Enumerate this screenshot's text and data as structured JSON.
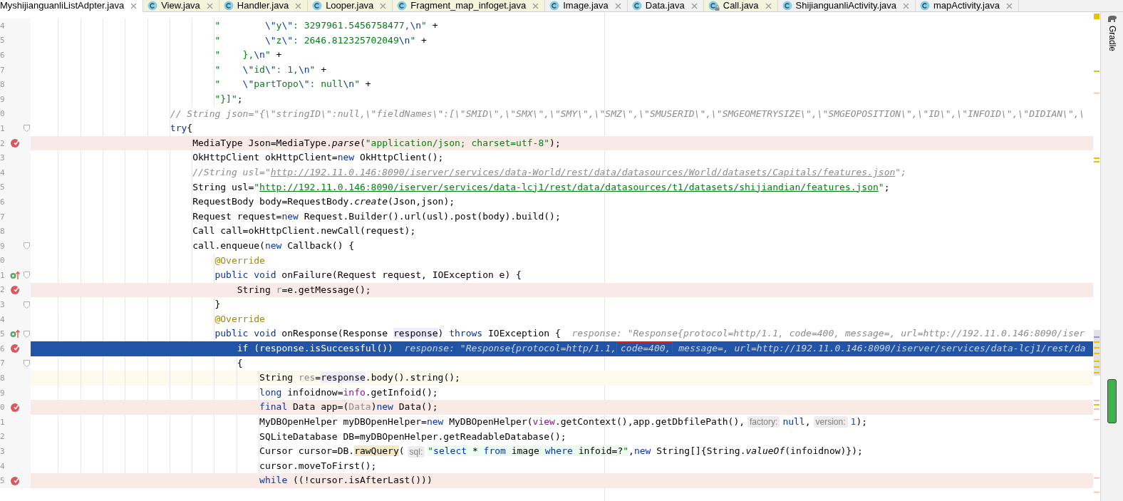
{
  "tabs": [
    {
      "label": "MyshijianguanliListAdpter.java",
      "selected": true,
      "color": "#ffffff",
      "icon": false,
      "locked": false
    },
    {
      "label": "View.java",
      "selected": false,
      "color": "#f4f4dd",
      "icon": true,
      "locked": false
    },
    {
      "label": "Handler.java",
      "selected": false,
      "color": "#f4f4dd",
      "icon": true,
      "locked": false
    },
    {
      "label": "Looper.java",
      "selected": false,
      "color": "#f4f4dd",
      "icon": true,
      "locked": false
    },
    {
      "label": "Fragment_map_infoget.java",
      "selected": false,
      "color": "#f4f4dd",
      "icon": true,
      "locked": false
    },
    {
      "label": "Image.java",
      "selected": false,
      "color": "#f2f2f2",
      "icon": true,
      "locked": false
    },
    {
      "label": "Data.java",
      "selected": false,
      "color": "#f2f2f2",
      "icon": true,
      "locked": false
    },
    {
      "label": "Call.java",
      "selected": false,
      "color": "#f4f4dd",
      "icon": true,
      "locked": true
    },
    {
      "label": "ShijianguanliActivity.java",
      "selected": false,
      "color": "#f2f2f2",
      "icon": true,
      "locked": false
    },
    {
      "label": "mapActivity.java",
      "selected": false,
      "color": "#f2f2f2",
      "icon": true,
      "locked": false
    }
  ],
  "editor": {
    "lines": [
      {
        "number": "4",
        "kind": "plain",
        "breakpoint": false,
        "override": false,
        "fold": false,
        "tokens": [
          {
            "kind": "string",
            "text": "                                \"        "
          },
          {
            "kind": "escape",
            "text": "\\\""
          },
          {
            "kind": "string",
            "text": "y"
          },
          {
            "kind": "escape",
            "text": "\\\""
          },
          {
            "kind": "string",
            "text": ": 3297961.5456758477,"
          },
          {
            "kind": "escape",
            "text": "\\n"
          },
          {
            "kind": "string",
            "text": "\""
          },
          {
            "kind": "plain",
            "text": " +"
          }
        ]
      },
      {
        "number": "5",
        "kind": "plain",
        "breakpoint": false,
        "override": false,
        "fold": false,
        "tokens": [
          {
            "kind": "string",
            "text": "                                \"        "
          },
          {
            "kind": "escape",
            "text": "\\\""
          },
          {
            "kind": "string",
            "text": "z"
          },
          {
            "kind": "escape",
            "text": "\\\""
          },
          {
            "kind": "string",
            "text": ": 2646.812325702049"
          },
          {
            "kind": "escape",
            "text": "\\n"
          },
          {
            "kind": "string",
            "text": "\""
          },
          {
            "kind": "plain",
            "text": " +"
          }
        ]
      },
      {
        "number": "6",
        "kind": "plain",
        "breakpoint": false,
        "override": false,
        "fold": false,
        "tokens": [
          {
            "kind": "string",
            "text": "                                \"    },"
          },
          {
            "kind": "escape",
            "text": "\\n"
          },
          {
            "kind": "string",
            "text": "\""
          },
          {
            "kind": "plain",
            "text": " +"
          }
        ]
      },
      {
        "number": "7",
        "kind": "plain",
        "breakpoint": false,
        "override": false,
        "fold": false,
        "tokens": [
          {
            "kind": "string",
            "text": "                                \"    "
          },
          {
            "kind": "escape",
            "text": "\\\""
          },
          {
            "kind": "string",
            "text": "id"
          },
          {
            "kind": "escape",
            "text": "\\\""
          },
          {
            "kind": "string",
            "text": ": 1,"
          },
          {
            "kind": "escape",
            "text": "\\n"
          },
          {
            "kind": "string",
            "text": "\""
          },
          {
            "kind": "plain",
            "text": " +"
          }
        ]
      },
      {
        "number": "8",
        "kind": "plain",
        "breakpoint": false,
        "override": false,
        "fold": false,
        "tokens": [
          {
            "kind": "string",
            "text": "                                \"    "
          },
          {
            "kind": "escape",
            "text": "\\\""
          },
          {
            "kind": "string",
            "text": "partTopo"
          },
          {
            "kind": "escape",
            "text": "\\\""
          },
          {
            "kind": "string",
            "text": ": null"
          },
          {
            "kind": "escape",
            "text": "\\n"
          },
          {
            "kind": "string",
            "text": "\""
          },
          {
            "kind": "plain",
            "text": " +"
          }
        ]
      },
      {
        "number": "9",
        "kind": "plain",
        "breakpoint": false,
        "override": false,
        "fold": false,
        "tokens": [
          {
            "kind": "string",
            "text": "                                \"}]\""
          },
          {
            "kind": "plain",
            "text": ";"
          }
        ]
      },
      {
        "number": "0",
        "kind": "plain",
        "breakpoint": false,
        "override": false,
        "fold": false,
        "tokens": [
          {
            "kind": "comment",
            "text": "                        // String json=\"{\\\"stringID\\\":null,\\\"fieldNames\\\":[\\\"SMID\\\",\\\"SMX\\\",\\\"SMY\\\",\\\"SMZ\\\",\\\"SMUSERID\\\",\\\"SMGEOMETRYSIZE\\\",\\\"SMGEOPOSITION\\\",\\\"ID\\\",\\\"INFOID\\\",\\\"DIDIAN\\\",\\"
          }
        ]
      },
      {
        "number": "1",
        "kind": "plain",
        "breakpoint": false,
        "override": false,
        "fold": true,
        "tokens": [
          {
            "kind": "keyword",
            "text": "                        try"
          },
          {
            "kind": "plain",
            "text": "{"
          }
        ]
      },
      {
        "number": "2",
        "kind": "breakpoint",
        "breakpoint": true,
        "override": false,
        "fold": false,
        "tokens": [
          {
            "kind": "plain",
            "text": "                            MediaType Json=MediaType."
          },
          {
            "kind": "static",
            "text": "parse"
          },
          {
            "kind": "plain",
            "text": "("
          },
          {
            "kind": "string",
            "text": "\"application/json; charset=utf-8\""
          },
          {
            "kind": "plain",
            "text": ");"
          }
        ]
      },
      {
        "number": "3",
        "kind": "plain",
        "breakpoint": false,
        "override": false,
        "fold": false,
        "tokens": [
          {
            "kind": "plain",
            "text": "                            OkHttpClient okHttpClient="
          },
          {
            "kind": "keyword",
            "text": "new"
          },
          {
            "kind": "plain",
            "text": " OkHttpClient();"
          }
        ]
      },
      {
        "number": "4",
        "kind": "plain",
        "breakpoint": false,
        "override": false,
        "fold": false,
        "tokens": [
          {
            "kind": "comment",
            "text": "                            //String usl=\""
          },
          {
            "kind": "comment-link",
            "text": "http://192.11.0.146:8090/iserver/services/data-World/rest/data/datasources/World/datasets/Capitals/features.json"
          },
          {
            "kind": "comment",
            "text": "\";"
          }
        ]
      },
      {
        "number": "5",
        "kind": "plain",
        "breakpoint": false,
        "override": false,
        "fold": false,
        "tokens": [
          {
            "kind": "plain",
            "text": "                            String usl="
          },
          {
            "kind": "string",
            "text": "\""
          },
          {
            "kind": "link",
            "text": "http://192.11.0.146:8090/iserver/services/data-lcj1/rest/data/datasources/t1/datasets/shijiandian/features.json"
          },
          {
            "kind": "string",
            "text": "\""
          },
          {
            "kind": "plain",
            "text": ";"
          }
        ]
      },
      {
        "number": "6",
        "kind": "plain",
        "breakpoint": false,
        "override": false,
        "fold": false,
        "tokens": [
          {
            "kind": "plain",
            "text": "                            RequestBody body=RequestBody."
          },
          {
            "kind": "static",
            "text": "create"
          },
          {
            "kind": "plain",
            "text": "(Json,json);"
          }
        ]
      },
      {
        "number": "7",
        "kind": "plain",
        "breakpoint": false,
        "override": false,
        "fold": false,
        "tokens": [
          {
            "kind": "plain",
            "text": "                            Request request="
          },
          {
            "kind": "keyword",
            "text": "new"
          },
          {
            "kind": "plain",
            "text": " Request.Builder().url(usl).post(body).build();"
          }
        ]
      },
      {
        "number": "8",
        "kind": "plain",
        "breakpoint": false,
        "override": false,
        "fold": false,
        "tokens": [
          {
            "kind": "plain",
            "text": "                            Call call=okHttpClient.newCall(request);"
          }
        ]
      },
      {
        "number": "9",
        "kind": "plain",
        "breakpoint": false,
        "override": false,
        "fold": true,
        "tokens": [
          {
            "kind": "plain",
            "text": "                            call.enqueue("
          },
          {
            "kind": "keyword",
            "text": "new"
          },
          {
            "kind": "plain",
            "text": " Callback() {"
          }
        ]
      },
      {
        "number": "0",
        "kind": "plain",
        "breakpoint": false,
        "override": false,
        "fold": false,
        "tokens": [
          {
            "kind": "annotation",
            "text": "                                @Override"
          }
        ]
      },
      {
        "number": "1",
        "kind": "plain",
        "breakpoint": false,
        "override": true,
        "fold": true,
        "tokens": [
          {
            "kind": "keyword",
            "text": "                                public void"
          },
          {
            "kind": "plain",
            "text": " onFailure(Request request, IOException e) {"
          }
        ]
      },
      {
        "number": "2",
        "kind": "breakpoint",
        "breakpoint": true,
        "override": false,
        "fold": false,
        "tokens": [
          {
            "kind": "plain",
            "text": "                                    String "
          },
          {
            "kind": "unused",
            "text": "r"
          },
          {
            "kind": "plain",
            "text": "=e.getMessage();"
          }
        ]
      },
      {
        "number": "3",
        "kind": "plain",
        "breakpoint": false,
        "override": false,
        "fold": true,
        "tokens": [
          {
            "kind": "plain",
            "text": "                                }"
          }
        ]
      },
      {
        "number": "4",
        "kind": "plain",
        "breakpoint": false,
        "override": false,
        "fold": false,
        "tokens": [
          {
            "kind": "annotation",
            "text": "                                @Override"
          }
        ]
      },
      {
        "number": "5",
        "kind": "plain",
        "breakpoint": false,
        "override": true,
        "fold": true,
        "tokens": [
          {
            "kind": "keyword",
            "text": "                                public void"
          },
          {
            "kind": "plain",
            "text": " onResponse(Response "
          },
          {
            "kind": "usage",
            "text": "response"
          },
          {
            "kind": "plain",
            "text": ") "
          },
          {
            "kind": "keyword",
            "text": "throws"
          },
          {
            "kind": "plain",
            "text": " IOException {"
          },
          {
            "kind": "debug",
            "text": "response: \"Response{protocol=http/1.1, code=400, message=, url=http://192.11.0.146:8090/iser"
          }
        ]
      },
      {
        "number": "6",
        "kind": "execution",
        "breakpoint": true,
        "override": false,
        "fold": false,
        "tokens": [
          {
            "kind": "keyword",
            "text": "                                    if"
          },
          {
            "kind": "plain",
            "text": " (response.isSuccessful())"
          },
          {
            "kind": "debug",
            "text": "response: \"Response{protocol=http/1.1,"
          },
          {
            "kind": "boxed",
            "text": "code=400,"
          },
          {
            "kind": "debug",
            "text": " message=, url=http://192.11.0.146:8090/iserver/services/data-lcj1/rest/da"
          }
        ]
      },
      {
        "number": "7",
        "kind": "plain",
        "breakpoint": false,
        "override": false,
        "fold": true,
        "tokens": [
          {
            "kind": "plain",
            "text": "                                    {"
          }
        ]
      },
      {
        "number": "8",
        "kind": "caret",
        "breakpoint": false,
        "override": false,
        "fold": false,
        "tokens": [
          {
            "kind": "plain",
            "text": "                                        String "
          },
          {
            "kind": "unused",
            "text": "res"
          },
          {
            "kind": "plain",
            "text": "="
          },
          {
            "kind": "usage",
            "text": "response"
          },
          {
            "kind": "plain",
            "text": ".body().string();"
          }
        ]
      },
      {
        "number": "9",
        "kind": "plain",
        "breakpoint": false,
        "override": false,
        "fold": false,
        "tokens": [
          {
            "kind": "keyword",
            "text": "                                        long"
          },
          {
            "kind": "plain",
            "text": " infoidnow="
          },
          {
            "kind": "field",
            "text": "info"
          },
          {
            "kind": "plain",
            "text": ".getInfoid();"
          }
        ]
      },
      {
        "number": "0",
        "kind": "breakpoint",
        "breakpoint": true,
        "override": false,
        "fold": false,
        "tokens": [
          {
            "kind": "keyword",
            "text": "                                        final"
          },
          {
            "kind": "plain",
            "text": " Data app=("
          },
          {
            "kind": "unused",
            "text": "Data"
          },
          {
            "kind": "plain",
            "text": ")"
          },
          {
            "kind": "keyword",
            "text": "new"
          },
          {
            "kind": "plain",
            "text": " Data();"
          }
        ]
      },
      {
        "number": "1",
        "kind": "plain",
        "breakpoint": false,
        "override": false,
        "fold": false,
        "tokens": [
          {
            "kind": "plain",
            "text": "                                        MyDBOpenHelper myDBOpenHelper="
          },
          {
            "kind": "keyword",
            "text": "new"
          },
          {
            "kind": "plain",
            "text": " MyDBOpenHelper("
          },
          {
            "kind": "field",
            "text": "view"
          },
          {
            "kind": "plain",
            "text": ".getContext(),app.getDbfilePath(),"
          },
          {
            "kind": "hint",
            "text": "factory:"
          },
          {
            "kind": "keyword",
            "text": "null"
          },
          {
            "kind": "plain",
            "text": ","
          },
          {
            "kind": "hint",
            "text": "version:"
          },
          {
            "kind": "number",
            "text": "1"
          },
          {
            "kind": "plain",
            "text": ");"
          }
        ]
      },
      {
        "number": "2",
        "kind": "plain",
        "breakpoint": false,
        "override": false,
        "fold": false,
        "tokens": [
          {
            "kind": "plain",
            "text": "                                        SQLiteDatabase DB=myDBOpenHelper.getReadableDatabase();"
          }
        ]
      },
      {
        "number": "3",
        "kind": "plain",
        "breakpoint": false,
        "override": false,
        "fold": false,
        "tokens": [
          {
            "kind": "plain",
            "text": "                                        Cursor cursor=DB."
          },
          {
            "kind": "match",
            "text": "rawQuery"
          },
          {
            "kind": "plain",
            "text": "("
          },
          {
            "kind": "hint",
            "text": "sql:"
          },
          {
            "kind": "sql-quote",
            "text": "\""
          },
          {
            "kind": "sql-keyword",
            "text": "select"
          },
          {
            "kind": "sql",
            "text": " * "
          },
          {
            "kind": "sql-keyword",
            "text": "from"
          },
          {
            "kind": "sql",
            "text": " image "
          },
          {
            "kind": "sql-keyword",
            "text": "where"
          },
          {
            "kind": "sql",
            "text": " infoid=?"
          },
          {
            "kind": "sql-quote",
            "text": "\""
          },
          {
            "kind": "plain",
            "text": ","
          },
          {
            "kind": "keyword",
            "text": "new"
          },
          {
            "kind": "plain",
            "text": " String[]{String."
          },
          {
            "kind": "static",
            "text": "valueOf"
          },
          {
            "kind": "plain",
            "text": "(infoidnow)});"
          }
        ]
      },
      {
        "number": "4",
        "kind": "plain",
        "breakpoint": false,
        "override": false,
        "fold": false,
        "tokens": [
          {
            "kind": "plain",
            "text": "                                        cursor.moveToFirst();"
          }
        ]
      },
      {
        "number": "5",
        "kind": "breakpoint",
        "breakpoint": true,
        "override": false,
        "fold": false,
        "tokens": [
          {
            "kind": "keyword",
            "text": "                                        while"
          },
          {
            "kind": "plain",
            "text": " ((!cursor.isAfterLast()))"
          }
        ]
      }
    ]
  },
  "tool_window": {
    "label": "Gradle"
  }
}
